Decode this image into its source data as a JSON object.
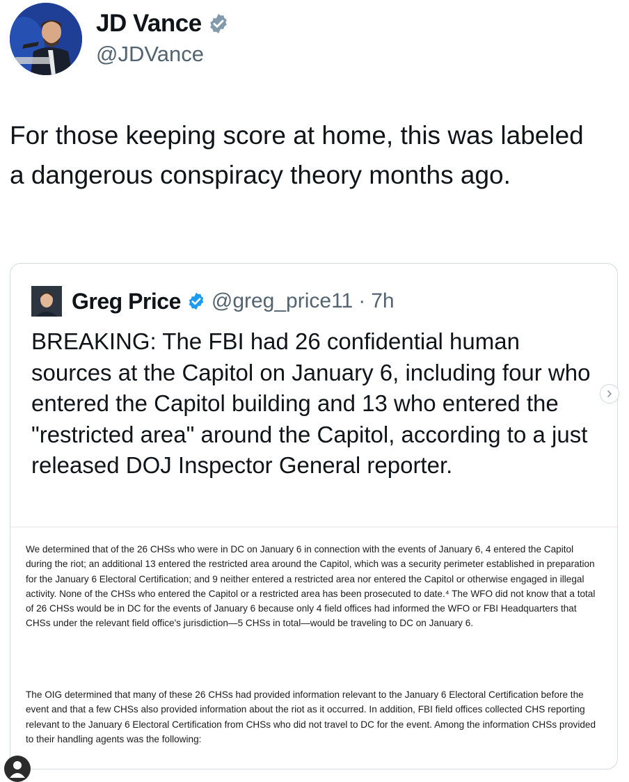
{
  "tweet": {
    "author": {
      "name": "JD Vance",
      "handle": "@JDVance",
      "verified_icon": "verified-badge-icon"
    },
    "text": "For those keeping score at home, this was labeled a dangerous conspiracy theory months ago."
  },
  "quoted_tweet": {
    "author": {
      "name": "Greg Price",
      "handle": "@greg_price11",
      "separator": "·",
      "time": "7h",
      "verified_icon": "verified-badge-icon"
    },
    "text": "BREAKING: The FBI had 26 confidential human sources at the Capitol on January 6, including four who entered the Capitol building and 13 who entered the \"restricted area\" around the Capitol, according to a just released DOJ Inspector General reporter.",
    "document": {
      "paragraph_1": "We determined that of the 26 CHSs who were in DC on January 6 in connection with the events of January 6, 4 entered the Capitol during the riot; an additional 13 entered the restricted area around the Capitol, which was a security perimeter established in preparation for the January 6 Electoral Certification; and 9 neither entered a restricted area nor entered the Capitol or otherwise engaged in illegal activity.  None of the CHSs who entered the Capitol or a restricted area has been prosecuted to date.⁴  The WFO did not know that a total of 26 CHSs would be in DC for the events of January 6 because only 4 field offices had informed the WFO or FBI Headquarters that CHSs under the relevant field office's jurisdiction—5 CHSs in total—would be traveling to DC on January 6.",
      "paragraph_2": "The OIG determined that many of these 26 CHSs had provided information relevant to the January 6 Electoral Certification before the event and that a few CHSs also provided information about the riot as it occurred.  In addition, FBI field offices collected CHS reporting relevant to the January 6 Electoral Certification from CHSs who did not travel to DC for the event.  Among the information CHSs provided to their handling agents was the following:"
    }
  },
  "colors": {
    "text_primary": "#0f1419",
    "text_secondary": "#536471",
    "verified_blue": "#1d9bf0",
    "verified_gray": "#829aab",
    "border": "#d4dbe1"
  },
  "icons": {
    "next": "chevron-right-icon",
    "profile": "person-icon"
  }
}
